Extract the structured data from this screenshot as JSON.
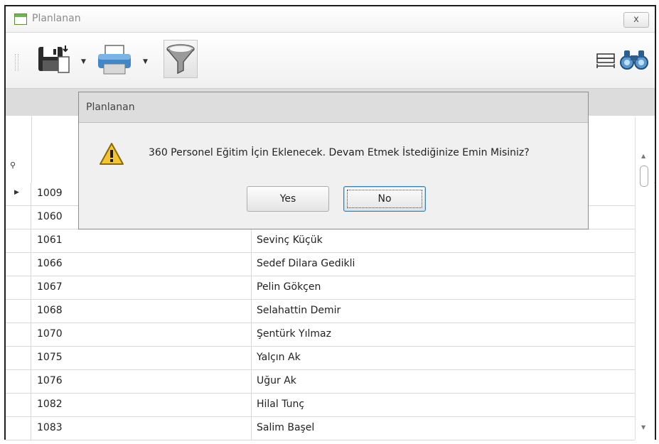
{
  "window": {
    "title": "Planlanan",
    "close_label": "x"
  },
  "toolbar": {
    "buttons": [
      "save-icon",
      "print-icon",
      "filter-icon",
      "column-width-icon",
      "binoculars-icon"
    ]
  },
  "dialog": {
    "title": "Planlanan",
    "message": "360 Personel Eğitim İçin Eklenecek. Devam Etmek İstediğinize Emin Misiniz?",
    "yes_label": "Yes",
    "no_label": "No",
    "icon": "warning-icon"
  },
  "grid": {
    "rows": [
      {
        "id": "1009",
        "name": ""
      },
      {
        "id": "1060",
        "name": ""
      },
      {
        "id": "1061",
        "name": "Sevinç Küçük"
      },
      {
        "id": "1066",
        "name": "Sedef Dilara Gedikli"
      },
      {
        "id": "1067",
        "name": "Pelin Gökçen"
      },
      {
        "id": "1068",
        "name": "Selahattin Demir"
      },
      {
        "id": "1070",
        "name": "Şentürk Yılmaz"
      },
      {
        "id": "1075",
        "name": "Yalçın Ak"
      },
      {
        "id": "1076",
        "name": "Uğur Ak"
      },
      {
        "id": "1082",
        "name": "Hilal Tunç"
      },
      {
        "id": "1083",
        "name": "Salim Başel"
      }
    ]
  }
}
